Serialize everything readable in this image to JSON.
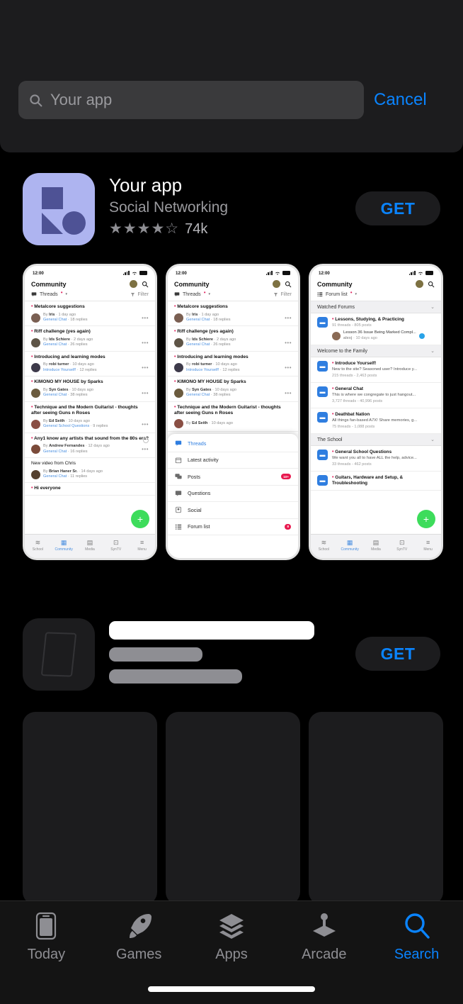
{
  "search": {
    "placeholder": "Your app",
    "value": "",
    "cancel_label": "Cancel",
    "icon": "search-icon"
  },
  "app_result": {
    "title": "Your app",
    "category": "Social Networking",
    "stars": "★★★★☆",
    "rating_count": "74k",
    "get_label": "GET",
    "accent_color": "#0a84ff",
    "icon_bg": "#aeb4f0",
    "icon_shape_color": "#4e5295"
  },
  "skeleton_app": {
    "get_label": "GET"
  },
  "screenshots": [
    {
      "status": {
        "time": "12:00"
      },
      "header": {
        "title": "Community",
        "avatar": "user-avatar",
        "search_icon": "search-icon"
      },
      "filterbar": {
        "left_label": "Threads",
        "right_label": "Filter",
        "left_icon": "threads-icon",
        "right_icon": "filter-icon"
      },
      "threads": [
        {
          "title": "Metalcore suggestions",
          "author": "Iris",
          "time": "1 day ago",
          "forum": "General Chat",
          "replies": "18 replies",
          "unread": true
        },
        {
          "title": "Riff challenge (yes again)",
          "author": "Ids Schiere",
          "time": "2 days ago",
          "forum": "General Chat",
          "replies": "26 replies",
          "unread": true
        },
        {
          "title": "Introducing and learning modes",
          "author": "robi turner",
          "time": "10 days ago",
          "forum": "Introduce Yourself!",
          "replies": "12 replies",
          "unread": true
        },
        {
          "title": "KIMONO MY HOUSE by Sparks",
          "author": "Syn Gates",
          "time": "10 days ago",
          "forum": "General Chat",
          "replies": "38 replies",
          "unread": true
        },
        {
          "title": "Technique and the Modern Guitarist - thoughts after seeing Guns n Roses",
          "author": "Ed Seith",
          "time": "10 days ago",
          "forum": "General School Questions",
          "replies": "9 replies",
          "unread": true
        },
        {
          "title": "Any1 know any artists that sound from the 80s era?",
          "author": "Andrew Fernandes",
          "time": "12 days ago",
          "forum": "General Chat",
          "replies": "16 replies",
          "unread": true
        },
        {
          "title": "New video from Chris",
          "author": "Brian Haner Sr.",
          "time": "14 days ago",
          "forum": "General Chat",
          "replies": "11 replies",
          "unread": false
        },
        {
          "title": "Hi everyone",
          "author": "",
          "time": "",
          "forum": "",
          "replies": "",
          "unread": true
        }
      ],
      "fab_label": "+",
      "tabs": [
        {
          "label": "School",
          "icon": "school-icon",
          "active": false
        },
        {
          "label": "Community",
          "icon": "community-icon",
          "active": true
        },
        {
          "label": "Media",
          "icon": "media-icon",
          "active": false
        },
        {
          "label": "SynTV",
          "icon": "syntv-icon",
          "active": false
        },
        {
          "label": "Menu",
          "icon": "menu-icon",
          "active": false
        }
      ]
    },
    {
      "overlay_menu": [
        {
          "label": "Threads",
          "icon": "threads-icon",
          "selected": true,
          "badge": ""
        },
        {
          "label": "Latest activity",
          "icon": "calendar-icon",
          "selected": false,
          "badge": ""
        },
        {
          "label": "Posts",
          "icon": "posts-icon",
          "selected": false,
          "badge": "10+"
        },
        {
          "label": "Questions",
          "icon": "question-icon",
          "selected": false,
          "badge": ""
        },
        {
          "label": "Social",
          "icon": "social-icon",
          "selected": false,
          "badge": ""
        },
        {
          "label": "Forum list",
          "icon": "forum-list-icon",
          "selected": false,
          "badge": "8"
        }
      ]
    },
    {
      "filterbar": {
        "left_label": "Forum list",
        "left_icon": "forum-list-icon"
      },
      "groups": [
        {
          "name": "Watched Forums",
          "forums": [
            {
              "name": "Lessons, Studying, & Practicing",
              "desc": "",
              "stats": "91 threads - 805 posts",
              "sub": {
                "title": "Lesson 36 Issue Being Marked Compl...",
                "author": "alexj",
                "time": "10 days ago"
              }
            }
          ]
        },
        {
          "name": "Welcome to the Family",
          "forums": [
            {
              "name": "Introduce Yourself!",
              "desc": "New to the site? Seasoned user? Introduce y...",
              "stats": "215 threads - 2,463 posts"
            },
            {
              "name": "General Chat",
              "desc": "This is where we congregate to just hangout...",
              "stats": "3,727 threads - 40,996 posts"
            },
            {
              "name": "Deathbat Nation",
              "desc": "All things fan-based A7X! Share memories, g...",
              "stats": "75 threads - 1,088 posts"
            }
          ]
        },
        {
          "name": "The School",
          "forums": [
            {
              "name": "General School Questions",
              "desc": "We want you all to have ALL the help, advice...",
              "stats": "33 threads - 462 posts"
            },
            {
              "name": "Guitars, Hardware and Setup, & Troubleshooting",
              "desc": "",
              "stats": ""
            }
          ]
        }
      ]
    }
  ],
  "tabbar": {
    "items": [
      {
        "label": "Today",
        "icon": "today-icon",
        "active": false
      },
      {
        "label": "Games",
        "icon": "rocket-icon",
        "active": false
      },
      {
        "label": "Apps",
        "icon": "layers-icon",
        "active": false
      },
      {
        "label": "Arcade",
        "icon": "joystick-icon",
        "active": false
      },
      {
        "label": "Search",
        "icon": "search-icon",
        "active": true
      }
    ],
    "active_color": "#0a84ff",
    "inactive_color": "#8e8e93"
  }
}
